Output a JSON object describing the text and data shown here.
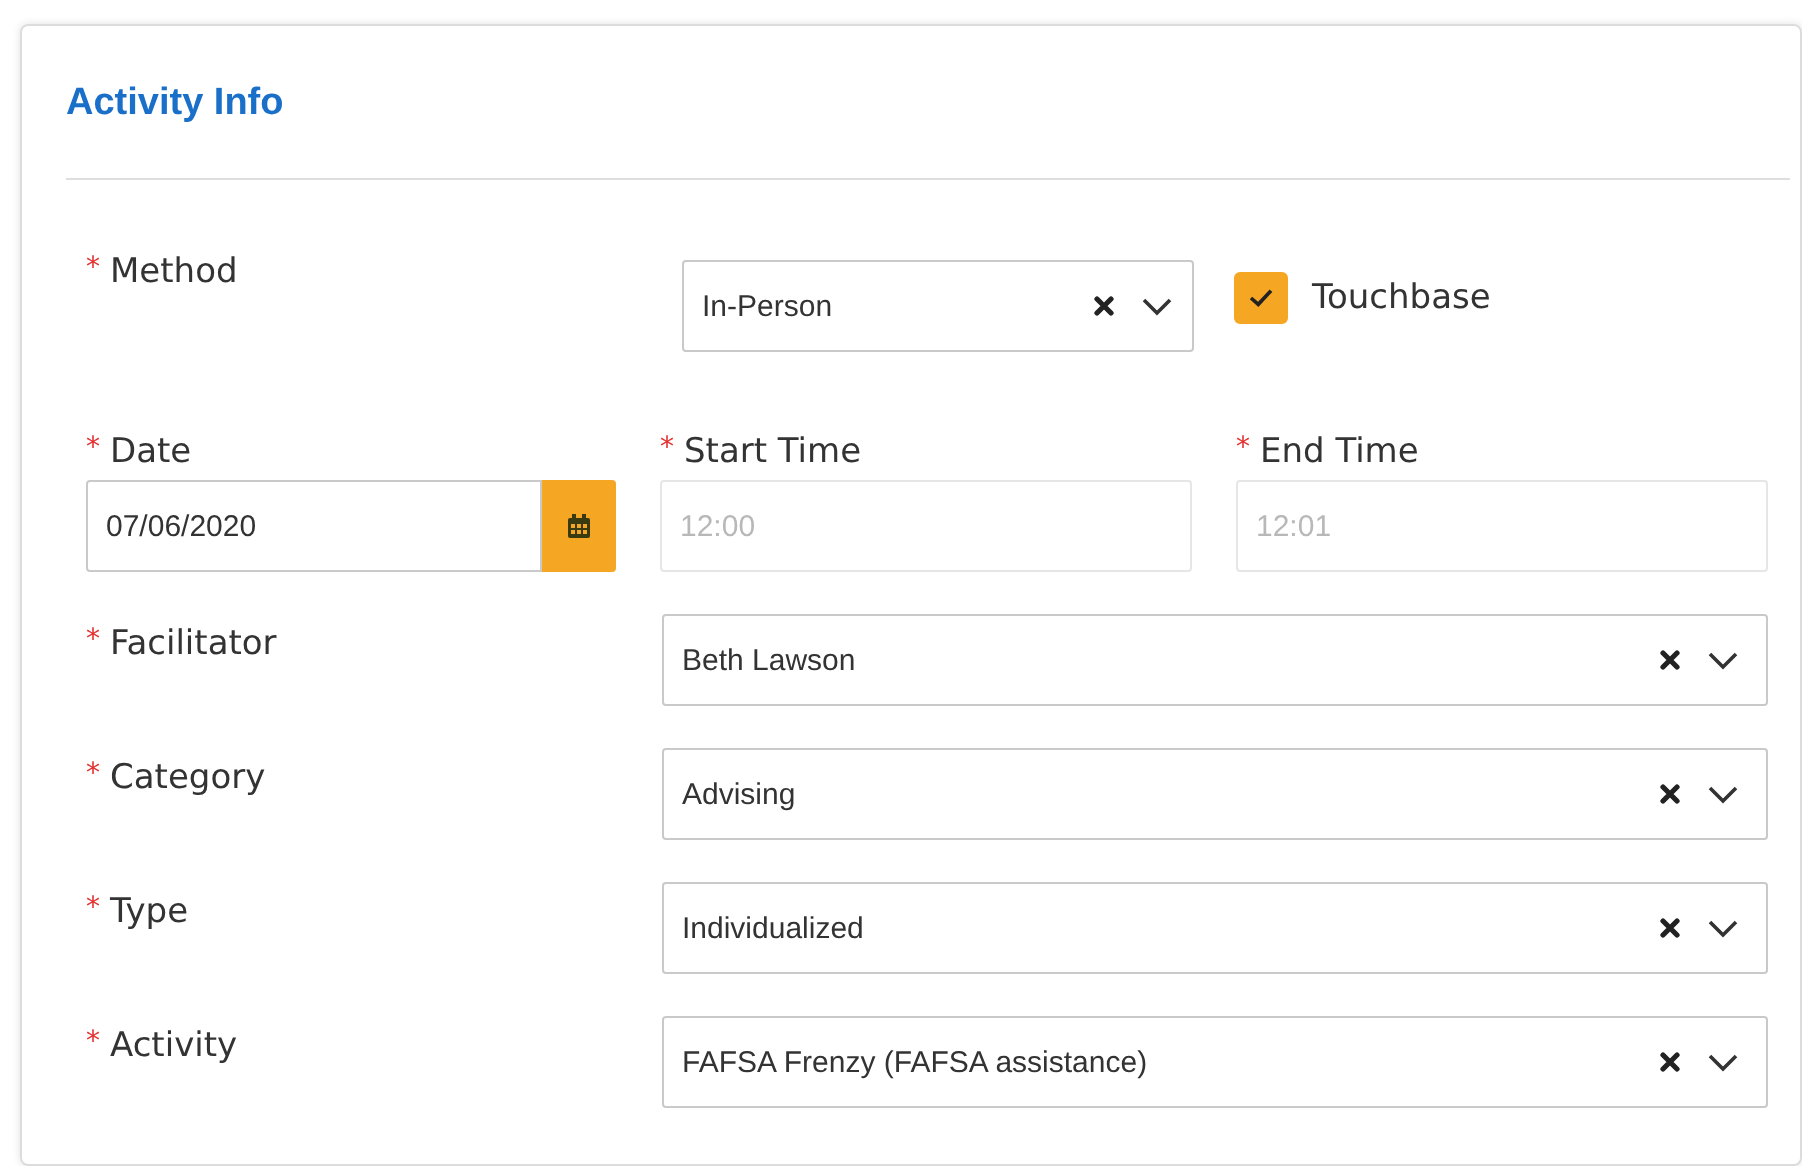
{
  "section": {
    "title": "Activity Info"
  },
  "method": {
    "required_mark": "*",
    "label": "Method",
    "value": "In-Person"
  },
  "touchbase": {
    "label": "Touchbase",
    "checked": true
  },
  "date": {
    "required_mark": "*",
    "label": "Date",
    "value": "07/06/2020"
  },
  "times": [
    {
      "required_mark": "*",
      "label": "Start Time",
      "value": "12:00",
      "disabled": true
    },
    {
      "required_mark": "*",
      "label": "End Time",
      "value": "12:01",
      "disabled": true
    }
  ],
  "selects": [
    {
      "required_mark": "*",
      "label": "Facilitator",
      "value": "Beth Lawson"
    },
    {
      "required_mark": "*",
      "label": "Category",
      "value": "Advising"
    },
    {
      "required_mark": "*",
      "label": "Type",
      "value": "Individualized"
    },
    {
      "required_mark": "*",
      "label": "Activity",
      "value": "FAFSA Frenzy (FAFSA assistance)"
    }
  ]
}
